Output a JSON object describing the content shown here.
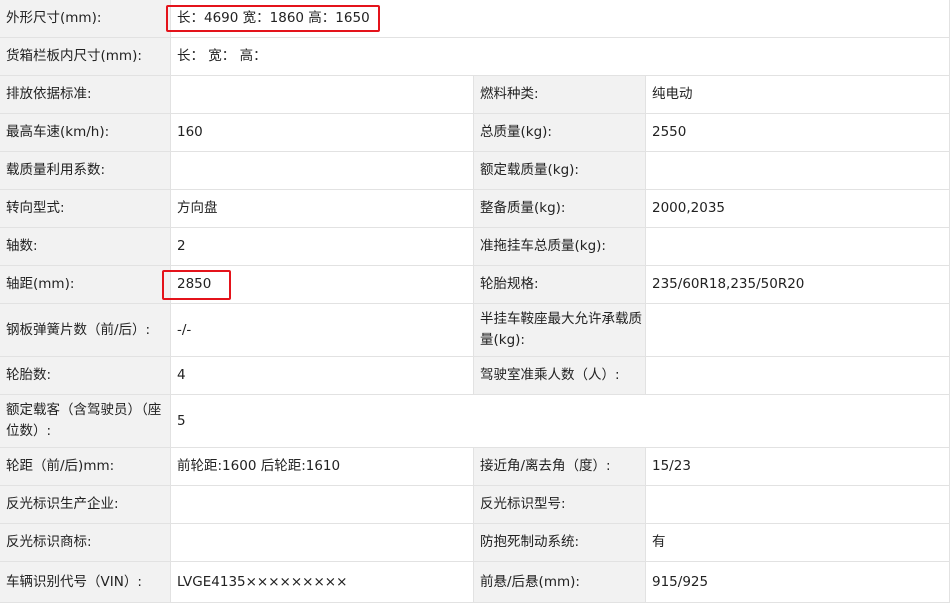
{
  "rows": [
    {
      "l1": "外形尺寸(mm):",
      "v1": "长：4690 宽：1860 高：1650"
    },
    {
      "l1": "货箱栏板内尺寸(mm):",
      "v1": "长：  宽：  高："
    },
    {
      "l1": "排放依据标准:",
      "v1": "",
      "l2": "燃料种类:",
      "v2": "纯电动"
    },
    {
      "l1": "最高车速(km/h):",
      "v1": "160",
      "l2": "总质量(kg):",
      "v2": "2550"
    },
    {
      "l1": "载质量利用系数:",
      "v1": "",
      "l2": "额定载质量(kg):",
      "v2": ""
    },
    {
      "l1": "转向型式:",
      "v1": "方向盘",
      "l2": "整备质量(kg):",
      "v2": "2000,2035"
    },
    {
      "l1": "轴数:",
      "v1": "2",
      "l2": "准拖挂车总质量(kg):",
      "v2": ""
    },
    {
      "l1": "轴距(mm):",
      "v1": "2850",
      "l2": "轮胎规格:",
      "v2": "235/60R18,235/50R20"
    },
    {
      "l1": "钢板弹簧片数（前/后）:",
      "v1": "-/-",
      "l2": "半挂车鞍座最大允许承载质量(kg):",
      "v2": ""
    },
    {
      "l1": "轮胎数:",
      "v1": "4",
      "l2": "驾驶室准乘人数（人）:",
      "v2": ""
    },
    {
      "l1": "额定载客（含驾驶员）（座位数）:",
      "v1": "5"
    },
    {
      "l1": "轮距（前/后)mm:",
      "v1": "前轮距:1600 后轮距:1610",
      "l2": "接近角/离去角（度）:",
      "v2": "15/23"
    },
    {
      "l1": "反光标识生产企业:",
      "v1": "",
      "l2": "反光标识型号:",
      "v2": ""
    },
    {
      "l1": "反光标识商标:",
      "v1": "",
      "l2": "防抱死制动系统:",
      "v2": "有"
    },
    {
      "l1": "车辆识别代号（VIN）:",
      "v1": "LVGE4135×××××××××",
      "l2": "前悬/后悬(mm):",
      "v2": "915/925"
    }
  ],
  "highlights": [
    "外形尺寸数值",
    "轴距数值"
  ],
  "highlight_color": "#e4131b"
}
